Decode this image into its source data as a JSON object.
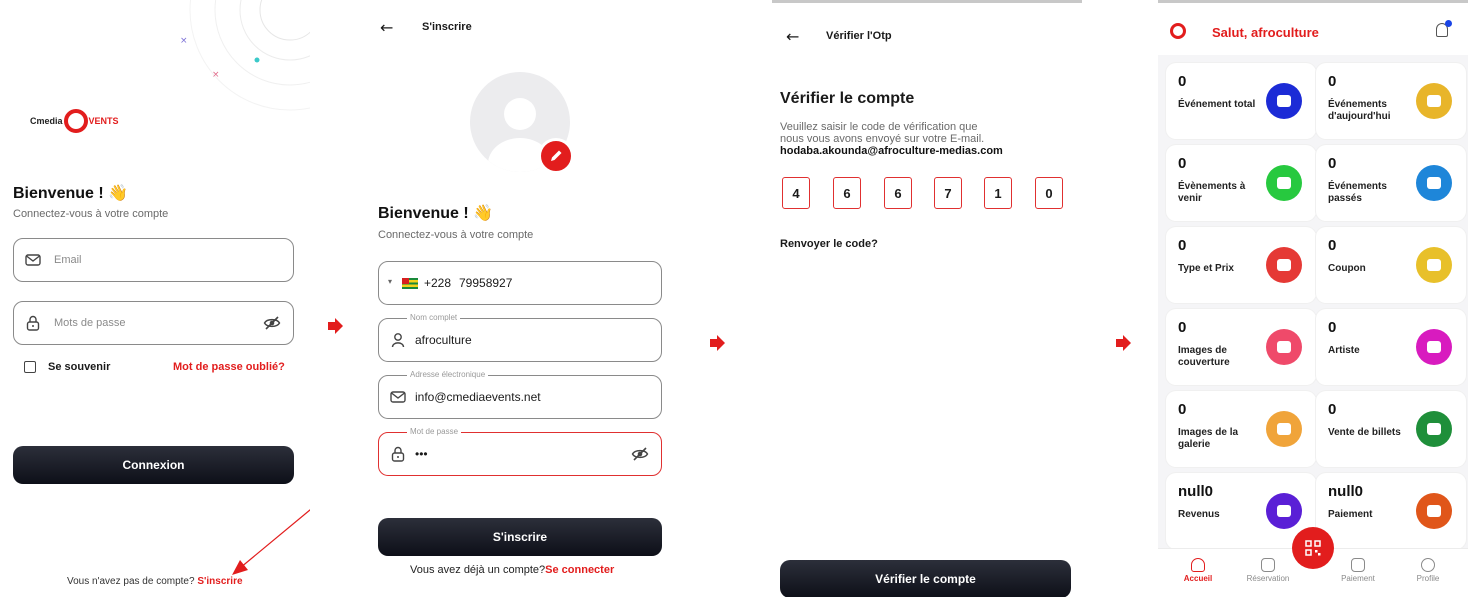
{
  "login": {
    "logo_prefix": "Cmedia",
    "logo_suffix": "VENTS",
    "welcome": "Bienvenue ! 👋",
    "subtitle": "Connectez-vous à votre compte",
    "email_placeholder": "Email",
    "password_placeholder": "Mots de passe",
    "remember": "Se souvenir",
    "forgot": "Mot de passe oublié?",
    "login_button": "Connexion",
    "no_account": "Vous n'avez pas de compte?",
    "signup_link": "S'inscrire"
  },
  "signup": {
    "header_title": "S'inscrire",
    "welcome": "Bienvenue ! 👋",
    "subtitle": "Connectez-vous à votre compte",
    "phone_code": "+228",
    "phone_value": "79958927",
    "name_legend": "Nom complet",
    "name_value": "afroculture",
    "email_legend": "Adresse électronique",
    "email_value": "info@cmediaevents.net",
    "password_legend": "Mot de passe",
    "password_value": "•••",
    "signup_button": "S'inscrire",
    "have_account": "Vous avez déjà un compte?",
    "login_link": "Se connecter"
  },
  "otp": {
    "header_title": "Vérifier l'Otp",
    "title": "Vérifier le compte",
    "instruction_1": "Veuillez saisir le code de vérification que",
    "instruction_2": "nous vous avons envoyé sur votre E-mail.",
    "email": "hodaba.akounda@afroculture-medias.com",
    "digits": [
      "4",
      "6",
      "6",
      "7",
      "1",
      "0"
    ],
    "resend": "Renvoyer le code?",
    "verify_button": "Vérifier le compte"
  },
  "dashboard": {
    "greeting": "Salut, afroculture",
    "cards": [
      {
        "value": "0",
        "label": "Événement total",
        "color": "#1c2bd6"
      },
      {
        "value": "0",
        "label": "Événements d'aujourd'hui",
        "color": "#e8b52a"
      },
      {
        "value": "0",
        "label": "Évènements à venir",
        "color": "#27c93f"
      },
      {
        "value": "0",
        "label": "Événements passés",
        "color": "#1e86d9"
      },
      {
        "value": "0",
        "label": "Type et Prix",
        "color": "#e53935"
      },
      {
        "value": "0",
        "label": "Coupon",
        "color": "#e8c02a"
      },
      {
        "value": "0",
        "label": "Images de couverture",
        "color": "#ef4a6a"
      },
      {
        "value": "0",
        "label": "Artiste",
        "color": "#d81bbf"
      },
      {
        "value": "0",
        "label": "Images de la galerie",
        "color": "#f0a43a"
      },
      {
        "value": "0",
        "label": "Vente de billets",
        "color": "#1f8f3a"
      },
      {
        "value": "null0",
        "label": "Revenus",
        "color": "#5a1fd6"
      },
      {
        "value": "null0",
        "label": "Paiement",
        "color": "#e0561a"
      }
    ],
    "nav": [
      "Accueil",
      "Réservation",
      "Paiement",
      "Profile"
    ]
  }
}
